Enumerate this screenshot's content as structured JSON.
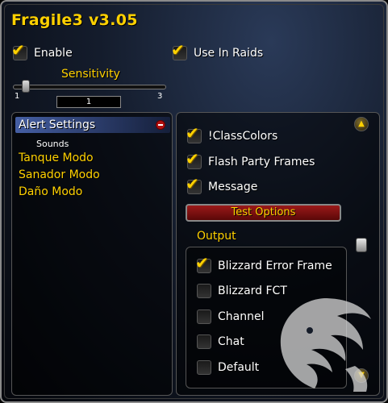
{
  "window": {
    "title": "Fragile3 v3.05"
  },
  "general": {
    "enable": {
      "label": "Enable",
      "checked": true
    },
    "use_in_raids": {
      "label": "Use In Raids",
      "checked": true
    }
  },
  "sensitivity": {
    "label": "Sensitivity",
    "min": "1",
    "max": "3",
    "value": "1"
  },
  "tree": {
    "items": [
      {
        "label": "Alert Settings",
        "selected": true
      },
      {
        "label": "Sounds",
        "sub": true
      },
      {
        "label": "Tanque Modo"
      },
      {
        "label": "Sanador Modo"
      },
      {
        "label": "Daño Modo"
      }
    ]
  },
  "alert_settings": {
    "options": [
      {
        "label": "!ClassColors",
        "checked": true
      },
      {
        "label": "Flash Party Frames",
        "checked": true
      },
      {
        "label": "Message",
        "checked": true
      }
    ],
    "test_button": "Test Options",
    "output_label": "Output",
    "outputs": [
      {
        "label": "Blizzard Error Frame",
        "checked": true
      },
      {
        "label": "Blizzard FCT",
        "checked": false
      },
      {
        "label": "Channel",
        "checked": false
      },
      {
        "label": "Chat",
        "checked": false
      },
      {
        "label": "Default",
        "checked": false
      }
    ]
  },
  "icons": {
    "check": "check-icon",
    "collapse": "minus-circle-icon",
    "scroll_up": "arrow-up-icon",
    "scroll_down": "arrow-down-icon",
    "watermark": "lion-head-icon"
  }
}
